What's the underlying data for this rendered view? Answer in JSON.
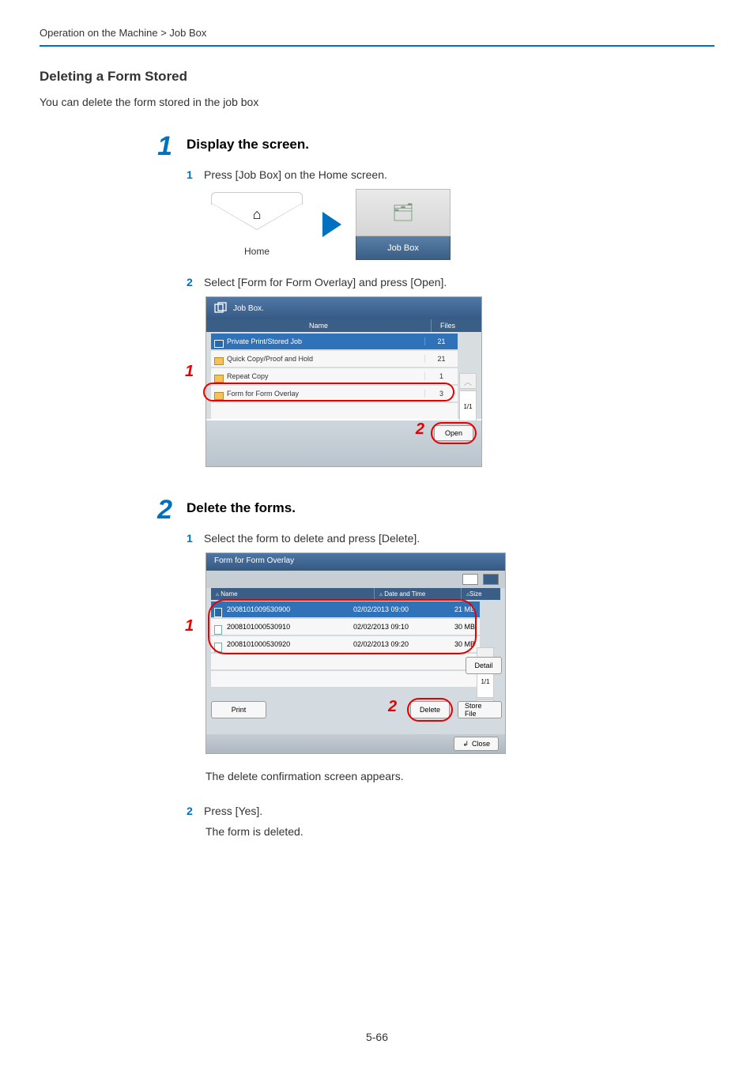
{
  "breadcrumb": "Operation on the Machine > Job Box",
  "h1": "Deleting a Form Stored",
  "intro": "You can delete the form stored in the job box",
  "step1": {
    "num": "1",
    "title": "Display the screen.",
    "sub1_num": "1",
    "sub1_text": "Press [Job Box] on the Home screen.",
    "sub2_num": "2",
    "sub2_text": "Select [Form for Form Overlay] and press [Open]."
  },
  "fig1": {
    "home_label": "Home",
    "jobbox_label": "Job Box"
  },
  "fig2": {
    "title": "Job Box.",
    "head_name": "Name",
    "head_files": "Files",
    "rows": [
      {
        "name": "Private Print/Stored Job",
        "files": "21"
      },
      {
        "name": "Quick Copy/Proof and Hold",
        "files": "21"
      },
      {
        "name": "Repeat Copy",
        "files": "1"
      },
      {
        "name": "Form for Form Overlay",
        "files": "3"
      }
    ],
    "page": "1/1",
    "open": "Open",
    "callout1": "1",
    "callout2": "2"
  },
  "step2": {
    "num": "2",
    "title": "Delete the forms.",
    "sub1_num": "1",
    "sub1_text": "Select the form to delete and press [Delete].",
    "after1": "The delete confirmation screen appears.",
    "sub2_num": "2",
    "sub2_text": "Press [Yes].",
    "after2": "The form is deleted."
  },
  "fig3": {
    "title": "Form for Form Overlay",
    "head_name": "Name",
    "head_date": "Date and Time",
    "head_size": "Size",
    "rows": [
      {
        "name": "2008101009530900",
        "date": "02/02/2013 09:00",
        "size": "21  MB"
      },
      {
        "name": "2008101000530910",
        "date": "02/02/2013 09:10",
        "size": "30  MB"
      },
      {
        "name": "2008101000530920",
        "date": "02/02/2013 09:20",
        "size": "30  MB"
      }
    ],
    "page": "1/1",
    "print": "Print",
    "delete": "Delete",
    "store": "Store File",
    "detail": "Detail",
    "close": "Close",
    "callout1": "1",
    "callout2": "2"
  },
  "page_num": "5-66"
}
